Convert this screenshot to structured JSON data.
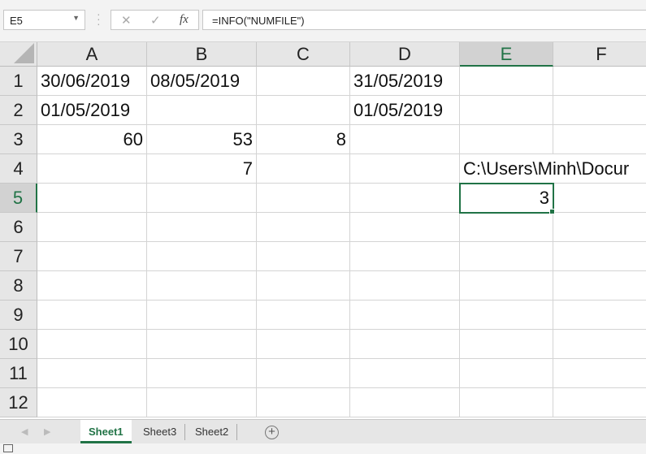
{
  "formula_bar": {
    "name_box": "E5",
    "formula": "=INFO(\"NUMFILE\")",
    "cancel_icon": "✕",
    "enter_icon": "✓",
    "fx_label": "fx"
  },
  "columns": [
    "A",
    "B",
    "C",
    "D",
    "E",
    "F"
  ],
  "rows": [
    "1",
    "2",
    "3",
    "4",
    "5",
    "6",
    "7",
    "8",
    "9",
    "10",
    "11",
    "12"
  ],
  "cells": {
    "A1": "30/06/2019",
    "B1": "08/05/2019",
    "D1": "31/05/2019",
    "A2": "01/05/2019",
    "D2": "01/05/2019",
    "A3": "60",
    "B3": "53",
    "C3": "8",
    "B4": "7",
    "E4": "C:\\Users\\Minh\\Docur",
    "E5": "3"
  },
  "sheet_tabs": [
    "Sheet1",
    "Sheet3",
    "Sheet2"
  ],
  "active_sheet": "Sheet1",
  "accent": "#217346"
}
